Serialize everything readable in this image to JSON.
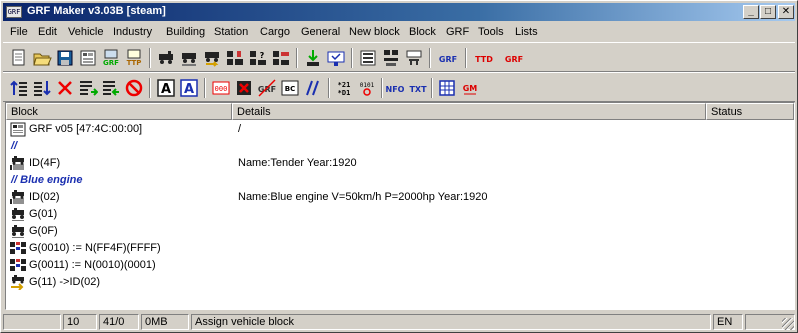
{
  "window": {
    "app_icon": "GRF",
    "title": "GRF Maker v3.03B  [steam]",
    "minimize": "_",
    "maximize": "□",
    "close": "✕"
  },
  "menu": [
    "File",
    "Edit",
    "Vehicle",
    "Industry",
    "Building",
    "Station",
    "Cargo",
    "General",
    "New block",
    "Block",
    "GRF",
    "Tools",
    "Lists"
  ],
  "toolbar1": {
    "icons": [
      "new-file-icon",
      "open-folder-icon",
      "save-icon",
      "grf-info-icon",
      "grf-block-icon",
      "ttp-block-icon",
      "vehicle-id-icon",
      "vehicle-graphics-icon",
      "vehicle-action-icon",
      "new-graphics-icon",
      "sprite-bitmap-icon",
      "grf-sprite-icon",
      "jump-icon",
      "insert-comment-icon",
      "display-icon",
      "sound-table-icon",
      "railtype-icon",
      "grf-red-icon",
      "ttd-label-icon",
      "grf-label-icon"
    ],
    "labels": {
      "grf": "GRF",
      "ttp": "TTP",
      "ttd": "TTD",
      "grf_red": "GRF"
    }
  },
  "toolbar2": {
    "labels": {
      "nfo": "NFO",
      "txt": "TXT",
      "gm": "GM",
      "grf": "GRF",
      "a1": "A",
      "a2": "A",
      "bc": "BC"
    }
  },
  "columns": [
    "Block",
    "Details",
    "Status"
  ],
  "rows": [
    {
      "icon": "grf-header-icon",
      "block": "GRF  v05  [47:4C:00:00]",
      "details": "/",
      "comment": false
    },
    {
      "icon": "",
      "block": "//",
      "details": "",
      "comment": true
    },
    {
      "icon": "vehicle-id-icon",
      "block": "ID(4F)",
      "details": "Name:Tender  Year:1920",
      "comment": false
    },
    {
      "icon": "",
      "block": "//  Blue engine",
      "details": "",
      "comment": true
    },
    {
      "icon": "vehicle-id-icon",
      "block": "ID(02)",
      "details": "Name:Blue engine  V=50km/h  P=2000hp  Year:1920",
      "comment": false
    },
    {
      "icon": "vehicle-graphics-icon",
      "block": "G(01)",
      "details": "",
      "comment": false
    },
    {
      "icon": "vehicle-graphics-icon",
      "block": "G(0F)",
      "details": "",
      "comment": false
    },
    {
      "icon": "variable-block-icon",
      "block": "G(0010) := N(FF4F)(FFFF)",
      "details": "",
      "comment": false
    },
    {
      "icon": "variable-block-icon",
      "block": "G(0011) := N(0010)(0001)",
      "details": "",
      "comment": false
    },
    {
      "icon": "assign-vehicle-icon",
      "block": "G(11) ->ID(02)",
      "details": "",
      "comment": false
    }
  ],
  "status": {
    "count": "10",
    "position": "41/0",
    "memory": "0MB",
    "message": "Assign vehicle block",
    "language": "EN"
  }
}
